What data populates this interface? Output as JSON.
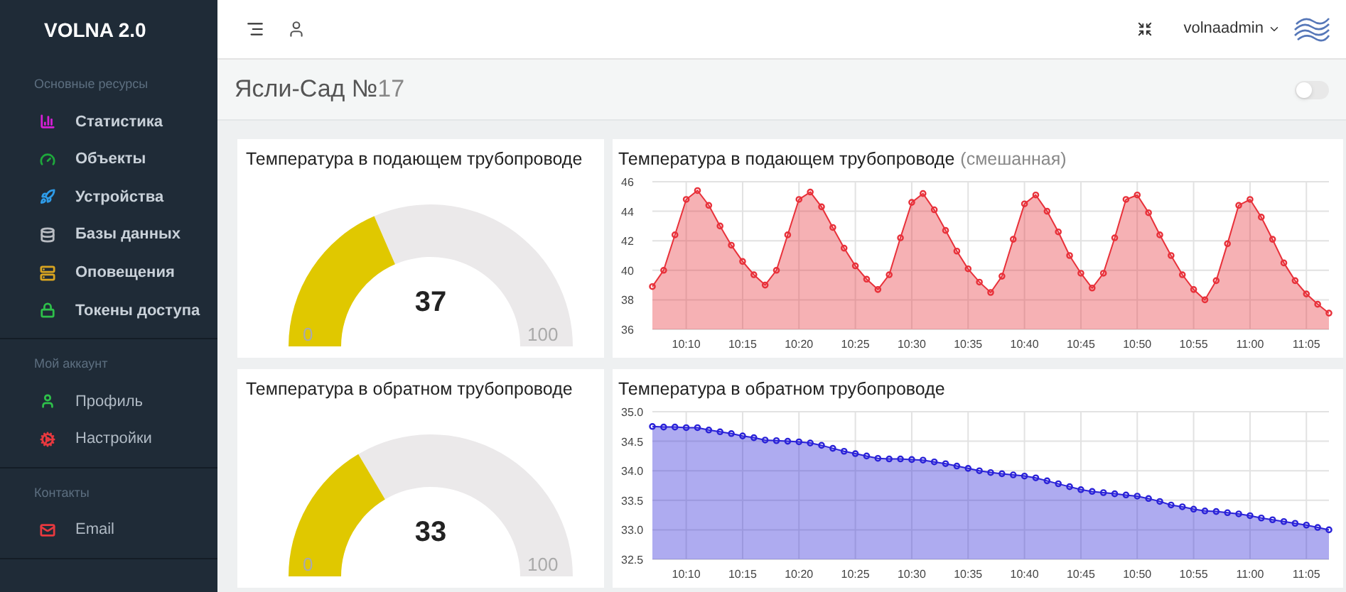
{
  "sidebar": {
    "brand": "VOLNA 2.0",
    "sections": [
      {
        "title": "Основные ресурсы",
        "items": [
          {
            "label": "Статистика",
            "color": "#d61fd6"
          },
          {
            "label": "Объекты",
            "color": "#1ea83c"
          },
          {
            "label": "Устройства",
            "color": "#2e9be8"
          },
          {
            "label": "Базы данных",
            "color": "#b8bcc2"
          },
          {
            "label": "Оповещения",
            "color": "#d9a520"
          },
          {
            "label": "Токены доступа",
            "color": "#2ec04a"
          }
        ]
      },
      {
        "title": "Мой аккаунт",
        "items": [
          {
            "label": "Профиль",
            "color": "#2ec04a"
          },
          {
            "label": "Настройки",
            "color": "#e8393f"
          }
        ]
      },
      {
        "title": "Контакты",
        "items": [
          {
            "label": "Email",
            "color": "#e8393f"
          }
        ]
      }
    ]
  },
  "topbar": {
    "username": "volnaadmin"
  },
  "page": {
    "title": "Ясли-Сад №",
    "title_number": "17",
    "toggle": {
      "on": false
    }
  },
  "gauges": [
    {
      "title": "Температура в подающем трубопроводе",
      "value": "37",
      "min": "0",
      "max": "100"
    },
    {
      "title": "Температура в обратном трубопроводе",
      "value": "33",
      "min": "0",
      "max": "100"
    }
  ],
  "charts": [
    {
      "title": "Температура в подающем трубопроводе",
      "title_note": "(смешанная)",
      "chart_data": {
        "type": "area",
        "grid": true,
        "ylim": [
          36,
          46
        ],
        "yticks": [
          36,
          38,
          40,
          42,
          44,
          46
        ],
        "categories": [
          null,
          null,
          null,
          "10:10",
          null,
          null,
          null,
          null,
          "10:15",
          null,
          null,
          null,
          null,
          "10:20",
          null,
          null,
          null,
          null,
          "10:25",
          null,
          null,
          null,
          null,
          "10:30",
          null,
          null,
          null,
          null,
          "10:35",
          null,
          null,
          null,
          null,
          "10:40",
          null,
          null,
          null,
          null,
          "10:45",
          null,
          null,
          null,
          null,
          "10:50",
          null,
          null,
          null,
          null,
          "10:55",
          null,
          null,
          null,
          null,
          "11:00",
          null,
          null,
          null,
          null,
          "11:05",
          null,
          null
        ],
        "series": [
          {
            "color": "#e8313a",
            "values": [
              38.9,
              40.0,
              42.4,
              44.8,
              45.4,
              44.4,
              43.0,
              41.7,
              40.6,
              39.7,
              39.0,
              40.0,
              42.4,
              44.8,
              45.3,
              44.3,
              42.9,
              41.5,
              40.3,
              39.4,
              38.7,
              39.7,
              42.2,
              44.6,
              45.2,
              44.1,
              42.7,
              41.3,
              40.1,
              39.2,
              38.5,
              39.6,
              42.1,
              44.5,
              45.1,
              44.0,
              42.6,
              41.0,
              39.8,
              38.8,
              39.8,
              42.2,
              44.8,
              45.1,
              43.9,
              42.4,
              41.0,
              39.7,
              38.7,
              38.0,
              39.3,
              41.8,
              44.4,
              44.8,
              43.6,
              42.1,
              40.5,
              39.3,
              38.4,
              37.7,
              37.1
            ]
          }
        ]
      }
    },
    {
      "title": "Температура в обратном трубопроводе",
      "chart_data": {
        "type": "area",
        "grid": true,
        "ylim": [
          32.5,
          35
        ],
        "yticks": [
          {
            "value": 32.5,
            "label": "32.5"
          },
          {
            "value": 33,
            "label": "33.0"
          },
          {
            "value": 33.5,
            "label": "33.5"
          },
          {
            "value": 34,
            "label": "34.0"
          },
          {
            "value": 34.5,
            "label": "34.5"
          },
          {
            "value": 35,
            "label": "35.0"
          }
        ],
        "categories": [
          null,
          null,
          null,
          "10:10",
          null,
          null,
          null,
          null,
          "10:15",
          null,
          null,
          null,
          null,
          "10:20",
          null,
          null,
          null,
          null,
          "10:25",
          null,
          null,
          null,
          null,
          "10:30",
          null,
          null,
          null,
          null,
          "10:35",
          null,
          null,
          null,
          null,
          "10:40",
          null,
          null,
          null,
          null,
          "10:45",
          null,
          null,
          null,
          null,
          "10:50",
          null,
          null,
          null,
          null,
          "10:55",
          null,
          null,
          null,
          null,
          "11:00",
          null,
          null,
          null,
          null,
          "11:05",
          null,
          null
        ],
        "series": [
          {
            "color": "#2a22d8",
            "values": [
              34.75,
              34.74,
              34.74,
              34.73,
              34.73,
              34.69,
              34.66,
              34.63,
              34.59,
              34.56,
              34.52,
              34.51,
              34.5,
              34.49,
              34.47,
              34.43,
              34.38,
              34.33,
              34.29,
              34.25,
              34.21,
              34.2,
              34.2,
              34.19,
              34.18,
              34.15,
              34.12,
              34.08,
              34.04,
              34.0,
              33.97,
              33.95,
              33.93,
              33.91,
              33.88,
              33.83,
              33.78,
              33.73,
              33.68,
              33.65,
              33.63,
              33.61,
              33.59,
              33.57,
              33.53,
              33.48,
              33.42,
              33.39,
              33.35,
              33.32,
              33.31,
              33.29,
              33.27,
              33.24,
              33.2,
              33.17,
              33.14,
              33.11,
              33.08,
              33.04,
              33.0
            ]
          }
        ]
      }
    }
  ]
}
